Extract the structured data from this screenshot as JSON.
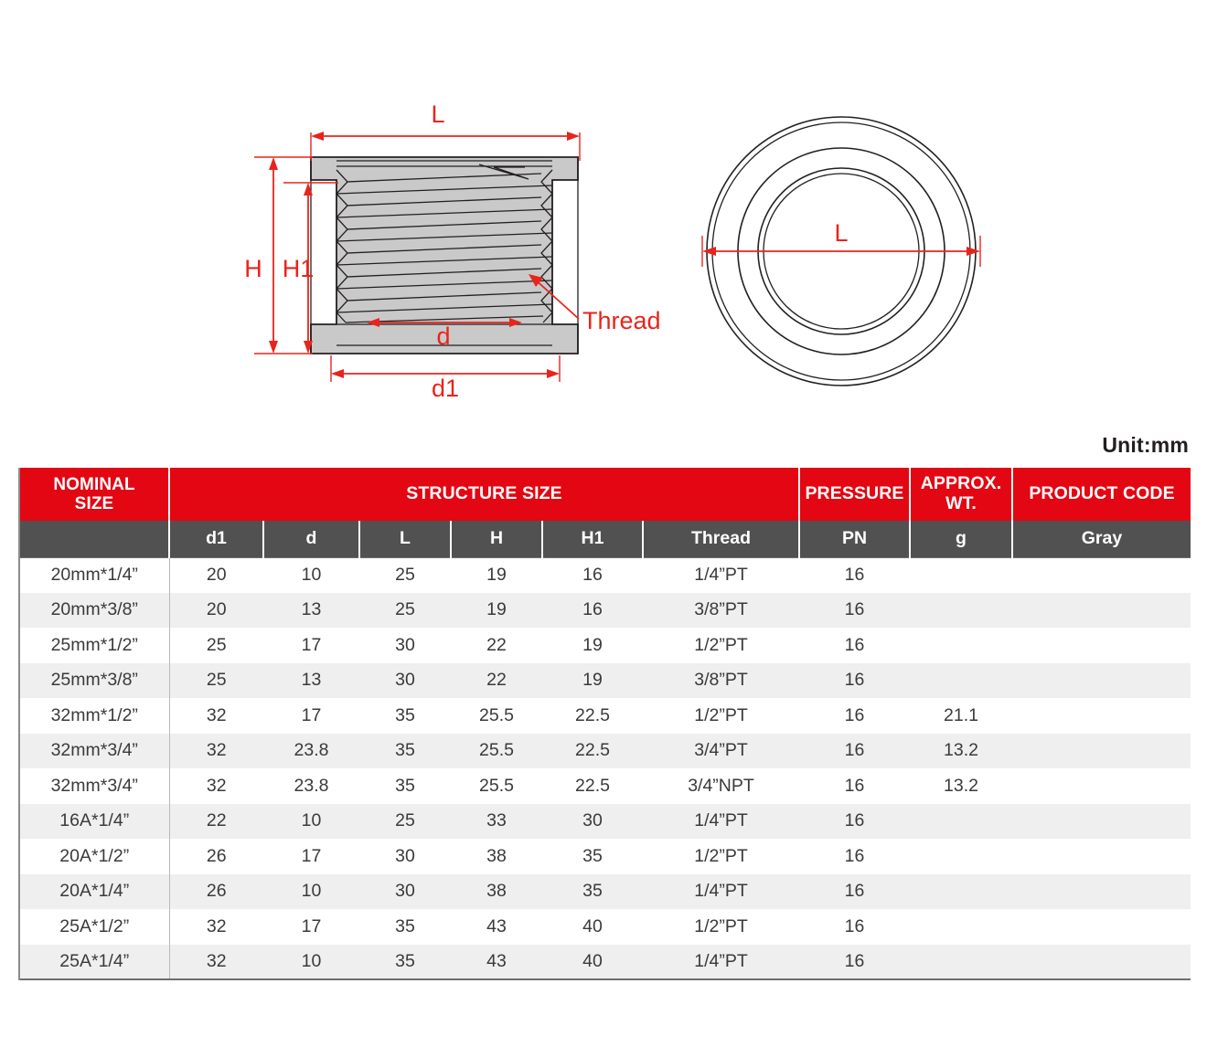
{
  "drawing": {
    "section_view": {
      "labels": {
        "L": "L",
        "H": "H",
        "H1": "H1",
        "d": "d",
        "d1": "d1",
        "thread": "Thread"
      }
    },
    "front_view": {
      "labels": {
        "L": "L"
      }
    }
  },
  "unit_note": "Unit:mm",
  "table": {
    "group_headers": [
      {
        "label": "NOMINAL SIZE",
        "line1": "NOMINAL",
        "line2": "SIZE"
      },
      {
        "label": "STRUCTURE SIZE"
      },
      {
        "label": "PRESSURE"
      },
      {
        "label": "APPROX. WT.",
        "line1": "APPROX.",
        "line2": "WT."
      },
      {
        "label": "PRODUCT CODE"
      }
    ],
    "sub_headers": [
      "",
      "d1",
      "d",
      "L",
      "H",
      "H1",
      "Thread",
      "PN",
      "g",
      "Gray"
    ],
    "rows": [
      {
        "nominal": "20mm*1/4”",
        "d1": "20",
        "d": "10",
        "L": "25",
        "H": "19",
        "H1": "16",
        "thread": "1/4”PT",
        "pn": "16",
        "g": "",
        "code": ""
      },
      {
        "nominal": "20mm*3/8”",
        "d1": "20",
        "d": "13",
        "L": "25",
        "H": "19",
        "H1": "16",
        "thread": "3/8”PT",
        "pn": "16",
        "g": "",
        "code": ""
      },
      {
        "nominal": "25mm*1/2”",
        "d1": "25",
        "d": "17",
        "L": "30",
        "H": "22",
        "H1": "19",
        "thread": "1/2”PT",
        "pn": "16",
        "g": "",
        "code": ""
      },
      {
        "nominal": "25mm*3/8”",
        "d1": "25",
        "d": "13",
        "L": "30",
        "H": "22",
        "H1": "19",
        "thread": "3/8”PT",
        "pn": "16",
        "g": "",
        "code": ""
      },
      {
        "nominal": "32mm*1/2”",
        "d1": "32",
        "d": "17",
        "L": "35",
        "H": "25.5",
        "H1": "22.5",
        "thread": "1/2”PT",
        "pn": "16",
        "g": "21.1",
        "code": ""
      },
      {
        "nominal": "32mm*3/4”",
        "d1": "32",
        "d": "23.8",
        "L": "35",
        "H": "25.5",
        "H1": "22.5",
        "thread": "3/4”PT",
        "pn": "16",
        "g": "13.2",
        "code": ""
      },
      {
        "nominal": "32mm*3/4”",
        "d1": "32",
        "d": "23.8",
        "L": "35",
        "H": "25.5",
        "H1": "22.5",
        "thread": "3/4”NPT",
        "pn": "16",
        "g": "13.2",
        "code": ""
      },
      {
        "nominal": "16A*1/4”",
        "d1": "22",
        "d": "10",
        "L": "25",
        "H": "33",
        "H1": "30",
        "thread": "1/4”PT",
        "pn": "16",
        "g": "",
        "code": ""
      },
      {
        "nominal": "20A*1/2”",
        "d1": "26",
        "d": "17",
        "L": "30",
        "H": "38",
        "H1": "35",
        "thread": "1/2”PT",
        "pn": "16",
        "g": "",
        "code": ""
      },
      {
        "nominal": "20A*1/4”",
        "d1": "26",
        "d": "10",
        "L": "30",
        "H": "38",
        "H1": "35",
        "thread": "1/4”PT",
        "pn": "16",
        "g": "",
        "code": ""
      },
      {
        "nominal": "25A*1/2”",
        "d1": "32",
        "d": "17",
        "L": "35",
        "H": "43",
        "H1": "40",
        "thread": "1/2”PT",
        "pn": "16",
        "g": "",
        "code": ""
      },
      {
        "nominal": "25A*1/4”",
        "d1": "32",
        "d": "10",
        "L": "35",
        "H": "43",
        "H1": "40",
        "thread": "1/4”PT",
        "pn": "16",
        "g": "",
        "code": ""
      }
    ]
  },
  "colors": {
    "header_red": "#e30613",
    "header_gray": "#515151",
    "annotation_red": "#e8241c",
    "part_fill": "#c9c9c9",
    "row_stripe": "#efefef"
  }
}
